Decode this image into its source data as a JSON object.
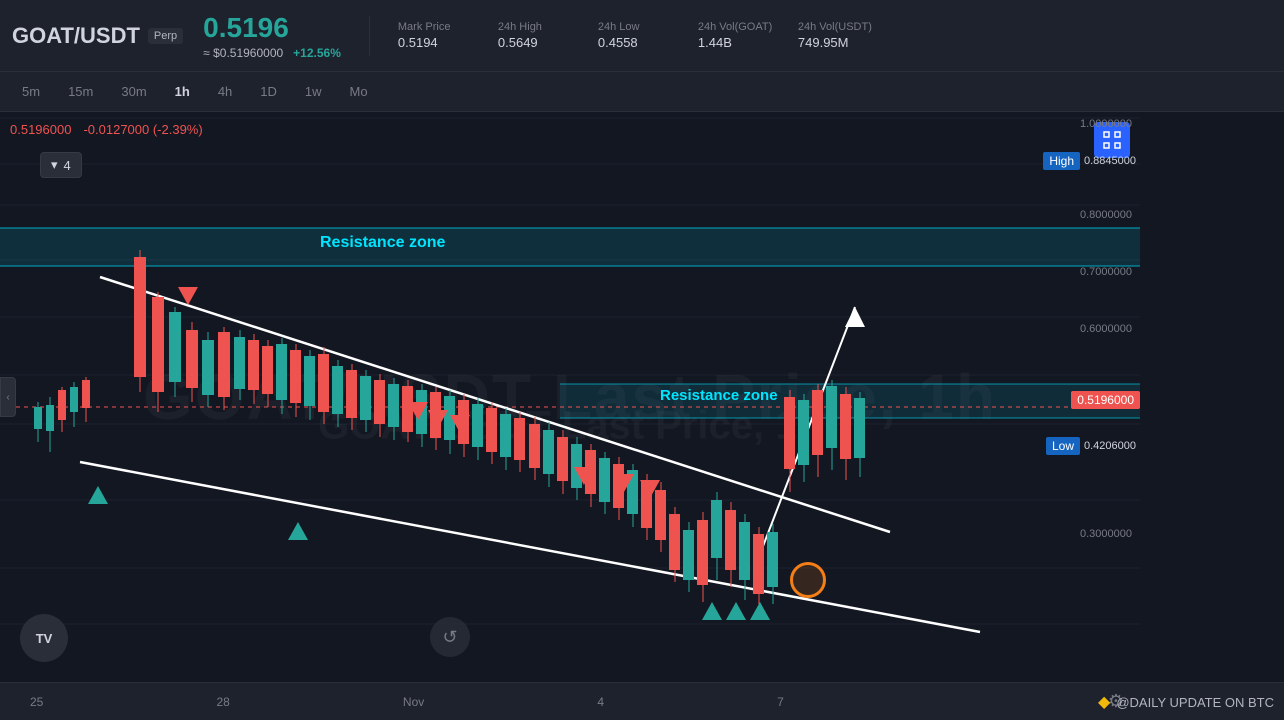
{
  "header": {
    "symbol": "GOAT/USDT",
    "badge": "Perp",
    "price_main": "0.5196",
    "price_usd": "≈ $0.51960000",
    "price_change": "+12.56%",
    "stats": [
      {
        "label": "Mark Price",
        "value": "0.5194"
      },
      {
        "label": "24h High",
        "value": "0.5649"
      },
      {
        "label": "24h Low",
        "value": "0.4558"
      },
      {
        "label": "24h Vol(GOAT)",
        "value": "1.44B"
      },
      {
        "label": "24h Vol(USDT)",
        "value": "749.95M"
      }
    ]
  },
  "timeframes": [
    "5m",
    "15m",
    "30m",
    "1h",
    "4h",
    "1D",
    "1w",
    "Mo"
  ],
  "active_timeframe": "1h",
  "chart": {
    "ohlc_label": "0.5196000",
    "change_label": "-0.0127000 (-2.39%)",
    "indicator": "4",
    "watermark_line1": "GOAT/USDT Last Price,",
    "watermark_line2": "GOAT/USDT Last Price, 1h",
    "resistance_label_top": "Resistance zone",
    "resistance_label_mid": "Resistance zone",
    "current_price_line": "0.5196000",
    "price_axis": [
      {
        "value": "1.0000000",
        "top_pct": 1
      },
      {
        "value": "0.8845000",
        "top_pct": 9,
        "type": "high"
      },
      {
        "value": "0.8000000",
        "top_pct": 16
      },
      {
        "value": "0.7000000",
        "top_pct": 26
      },
      {
        "value": "0.6000000",
        "top_pct": 36
      },
      {
        "value": "0.5196000",
        "top_pct": 46,
        "type": "current"
      },
      {
        "value": "0.4206000",
        "top_pct": 55,
        "type": "low"
      },
      {
        "value": "0.3000000",
        "top_pct": 68
      }
    ]
  },
  "bottom_bar": {
    "dates": [
      "25",
      "28",
      "Nov",
      "4",
      "7"
    ],
    "settings_icon": "⚙",
    "branding": "◆ @DAILY UPDATE ON BTC"
  }
}
